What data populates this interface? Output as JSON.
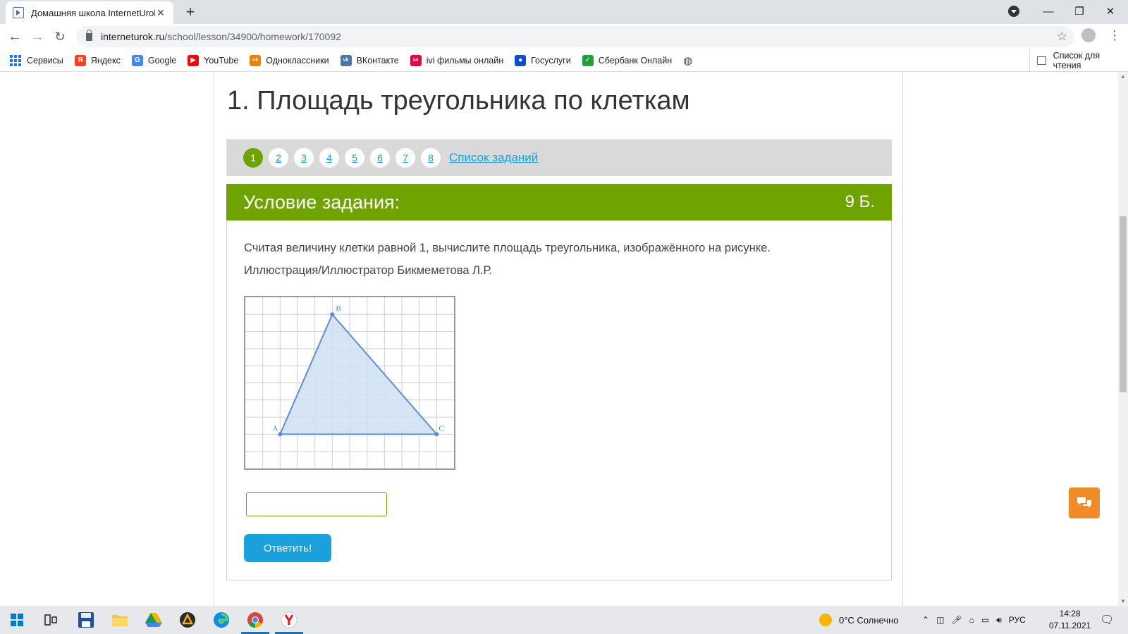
{
  "browser": {
    "tab_title": "Домашняя школа InternetUrok.r",
    "url_host": "interneturok.ru",
    "url_path": "/school/lesson/34900/homework/170092",
    "bookmarks": [
      {
        "label": "Сервисы",
        "icon": "apps-icon"
      },
      {
        "label": "Яндекс",
        "icon": "yandex-icon",
        "color": "#fc3f1d",
        "glyph": "Я"
      },
      {
        "label": "Google",
        "icon": "google-icon",
        "color": "#4285f4",
        "glyph": "G"
      },
      {
        "label": "YouTube",
        "icon": "youtube-icon",
        "color": "#ff0000",
        "glyph": "▶"
      },
      {
        "label": "Одноклассники",
        "icon": "odnoklassniki-icon",
        "color": "#ee8208",
        "glyph": "ok"
      },
      {
        "label": "ВКонтакте",
        "icon": "vk-icon",
        "color": "#4a76a8",
        "glyph": "vk"
      },
      {
        "label": "ivi фильмы онлайн",
        "icon": "ivi-icon",
        "color": "#ea003d",
        "glyph": "ivi"
      },
      {
        "label": "Госуслуги",
        "icon": "gosuslugi-icon",
        "color": "#0d4cd3",
        "glyph": "●"
      },
      {
        "label": "Сбербанк Онлайн",
        "icon": "sberbank-icon",
        "color": "#21a038",
        "glyph": "✓"
      }
    ],
    "reading_list": "Список для чтения"
  },
  "lesson": {
    "title": "1. Площадь треугольника по клеткам",
    "task_numbers": [
      "1",
      "2",
      "3",
      "4",
      "5",
      "6",
      "7",
      "8"
    ],
    "active_task": "1",
    "tasks_link": "Список заданий"
  },
  "task": {
    "header": "Условие задания:",
    "score": "9 Б.",
    "text_line1": "Считая величину клетки равной 1, вычислите площадь треугольника, изображённого на рисунке.",
    "text_line2": "Иллюстрация/Иллюстратор Бикмеметова Л.Р.",
    "figure": {
      "labels": {
        "a": "A",
        "b": "B",
        "c": "C"
      },
      "grid_cells": {
        "cols": 12,
        "rows": 10
      },
      "points": {
        "A": [
          2,
          2
        ],
        "B": [
          5,
          9
        ],
        "C": [
          11,
          2
        ]
      },
      "colors": {
        "grid": "#c9d0d8",
        "fill": "#cfe0f3",
        "stroke": "#5b8fd1",
        "label": "#4a7cc0"
      }
    },
    "answer_value": "",
    "submit_label": "Ответить!"
  },
  "taskbar": {
    "weather": "0°C Солнечно",
    "lang": "РУС",
    "time": "14:28",
    "date": "07.11.2021"
  },
  "colors": {
    "accent_green": "#6fa300",
    "link_blue": "#1a9fd9",
    "button_blue": "#1aa0dc",
    "chat_orange": "#f08c28"
  }
}
